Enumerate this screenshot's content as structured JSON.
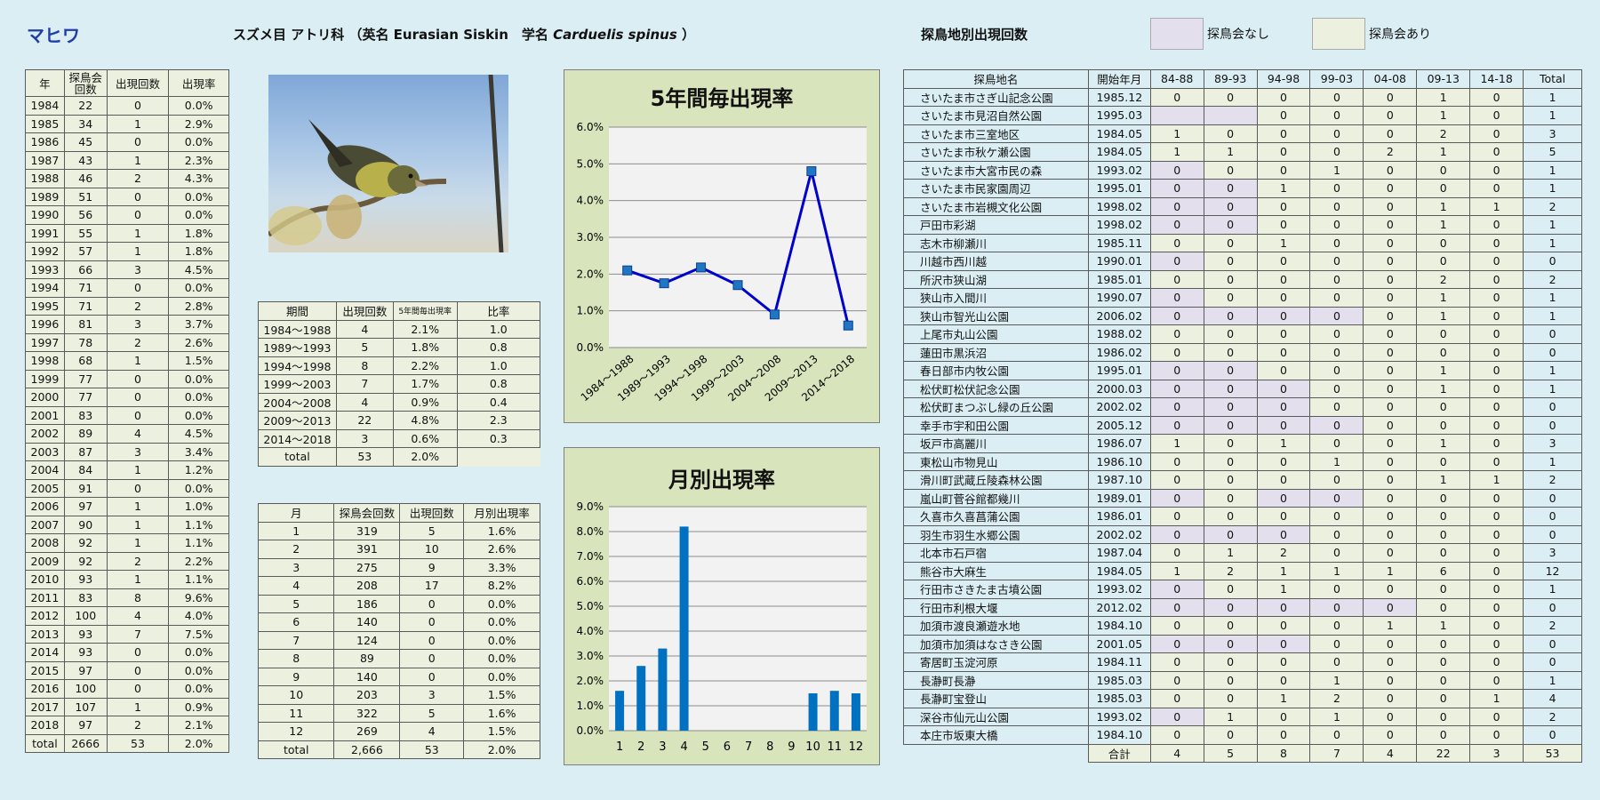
{
  "header": {
    "species": "マヒワ",
    "sub1": "スズメ目 アトリ科 （英名 Eurasian Siskin　学名 ",
    "sub_sci": "Carduelis spinus",
    "sub2": " ）",
    "sites_title": "探鳥地別出現回数",
    "legend_none": "探鳥会なし",
    "legend_held": "探鳥会あり"
  },
  "colors": {
    "no_event": "#e4dfec",
    "event": "#ebf1de",
    "line": "#0000cc",
    "marker": "#1f77c4",
    "bar": "#0070c0",
    "panel": "#d7e4bc"
  },
  "yearly": {
    "headers": [
      "年",
      "探鳥会回数",
      "出現回数",
      "出現率"
    ],
    "rows": [
      [
        "1984",
        "22",
        "0",
        "0.0%"
      ],
      [
        "1985",
        "34",
        "1",
        "2.9%"
      ],
      [
        "1986",
        "45",
        "0",
        "0.0%"
      ],
      [
        "1987",
        "43",
        "1",
        "2.3%"
      ],
      [
        "1988",
        "46",
        "2",
        "4.3%"
      ],
      [
        "1989",
        "51",
        "0",
        "0.0%"
      ],
      [
        "1990",
        "56",
        "0",
        "0.0%"
      ],
      [
        "1991",
        "55",
        "1",
        "1.8%"
      ],
      [
        "1992",
        "57",
        "1",
        "1.8%"
      ],
      [
        "1993",
        "66",
        "3",
        "4.5%"
      ],
      [
        "1994",
        "71",
        "0",
        "0.0%"
      ],
      [
        "1995",
        "71",
        "2",
        "2.8%"
      ],
      [
        "1996",
        "81",
        "3",
        "3.7%"
      ],
      [
        "1997",
        "78",
        "2",
        "2.6%"
      ],
      [
        "1998",
        "68",
        "1",
        "1.5%"
      ],
      [
        "1999",
        "77",
        "0",
        "0.0%"
      ],
      [
        "2000",
        "77",
        "0",
        "0.0%"
      ],
      [
        "2001",
        "83",
        "0",
        "0.0%"
      ],
      [
        "2002",
        "89",
        "4",
        "4.5%"
      ],
      [
        "2003",
        "87",
        "3",
        "3.4%"
      ],
      [
        "2004",
        "84",
        "1",
        "1.2%"
      ],
      [
        "2005",
        "91",
        "0",
        "0.0%"
      ],
      [
        "2006",
        "97",
        "1",
        "1.0%"
      ],
      [
        "2007",
        "90",
        "1",
        "1.1%"
      ],
      [
        "2008",
        "92",
        "1",
        "1.1%"
      ],
      [
        "2009",
        "92",
        "2",
        "2.2%"
      ],
      [
        "2010",
        "93",
        "1",
        "1.1%"
      ],
      [
        "2011",
        "83",
        "8",
        "9.6%"
      ],
      [
        "2012",
        "100",
        "4",
        "4.0%"
      ],
      [
        "2013",
        "93",
        "7",
        "7.5%"
      ],
      [
        "2014",
        "93",
        "0",
        "0.0%"
      ],
      [
        "2015",
        "97",
        "0",
        "0.0%"
      ],
      [
        "2016",
        "100",
        "0",
        "0.0%"
      ],
      [
        "2017",
        "107",
        "1",
        "0.9%"
      ],
      [
        "2018",
        "97",
        "2",
        "2.1%"
      ]
    ],
    "total": [
      "total",
      "2666",
      "53",
      "2.0%"
    ]
  },
  "period": {
    "headers": [
      "期間",
      "出現回数",
      "5年間毎出現率",
      "比率"
    ],
    "rows": [
      [
        "1984～1988",
        "4",
        "2.1%",
        "1.0"
      ],
      [
        "1989～1993",
        "5",
        "1.8%",
        "0.8"
      ],
      [
        "1994～1998",
        "8",
        "2.2%",
        "1.0"
      ],
      [
        "1999～2003",
        "7",
        "1.7%",
        "0.8"
      ],
      [
        "2004～2008",
        "4",
        "0.9%",
        "0.4"
      ],
      [
        "2009～2013",
        "22",
        "4.8%",
        "2.3"
      ],
      [
        "2014～2018",
        "3",
        "0.6%",
        "0.3"
      ]
    ],
    "total": [
      "total",
      "53",
      "2.0%"
    ]
  },
  "monthly": {
    "headers": [
      "月",
      "探鳥会回数",
      "出現回数",
      "月別出現率"
    ],
    "rows": [
      [
        "1",
        "319",
        "5",
        "1.6%"
      ],
      [
        "2",
        "391",
        "10",
        "2.6%"
      ],
      [
        "3",
        "275",
        "9",
        "3.3%"
      ],
      [
        "4",
        "208",
        "17",
        "8.2%"
      ],
      [
        "5",
        "186",
        "0",
        "0.0%"
      ],
      [
        "6",
        "140",
        "0",
        "0.0%"
      ],
      [
        "7",
        "124",
        "0",
        "0.0%"
      ],
      [
        "8",
        "89",
        "0",
        "0.0%"
      ],
      [
        "9",
        "140",
        "0",
        "0.0%"
      ],
      [
        "10",
        "203",
        "3",
        "1.5%"
      ],
      [
        "11",
        "322",
        "5",
        "1.6%"
      ],
      [
        "12",
        "269",
        "4",
        "1.5%"
      ]
    ],
    "total": [
      "total",
      "2,666",
      "53",
      "2.0%"
    ]
  },
  "chart_data": [
    {
      "type": "line",
      "title": "5年間毎出現率",
      "categories": [
        "1984～1988",
        "1989～1993",
        "1994～1998",
        "1999～2003",
        "2004～2008",
        "2009～2013",
        "2014～2018"
      ],
      "values": [
        2.1,
        1.75,
        2.18,
        1.7,
        0.9,
        4.8,
        0.6
      ],
      "ylim": [
        0,
        6
      ],
      "yticks": [
        "0.0%",
        "1.0%",
        "2.0%",
        "3.0%",
        "4.0%",
        "5.0%",
        "6.0%"
      ]
    },
    {
      "type": "bar",
      "title": "月別出現率",
      "categories": [
        "1",
        "2",
        "3",
        "4",
        "5",
        "6",
        "7",
        "8",
        "9",
        "10",
        "11",
        "12"
      ],
      "values": [
        1.6,
        2.6,
        3.3,
        8.2,
        0,
        0,
        0,
        0,
        0,
        1.5,
        1.6,
        1.5
      ],
      "ylim": [
        0,
        9
      ],
      "yticks": [
        "0.0%",
        "1.0%",
        "2.0%",
        "3.0%",
        "4.0%",
        "5.0%",
        "6.0%",
        "7.0%",
        "8.0%",
        "9.0%"
      ]
    }
  ],
  "sites": {
    "headers": [
      "探鳥地名",
      "開始年月",
      "84-88",
      "89-93",
      "94-98",
      "99-03",
      "04-08",
      "09-13",
      "14-18",
      "Total"
    ],
    "rows": [
      {
        "name": "さいたま市さぎ山記念公園",
        "start": "1985.12",
        "v": [
          "0",
          "0",
          "0",
          "0",
          "0",
          "1",
          "0",
          "1"
        ],
        "none": []
      },
      {
        "name": "さいたま市見沼自然公園",
        "start": "1995.03",
        "v": [
          "",
          "",
          "0",
          "0",
          "0",
          "1",
          "0",
          "1"
        ],
        "none": [
          0,
          1
        ]
      },
      {
        "name": "さいたま市三室地区",
        "start": "1984.05",
        "v": [
          "1",
          "0",
          "0",
          "0",
          "0",
          "2",
          "0",
          "3"
        ],
        "none": []
      },
      {
        "name": "さいたま市秋ケ瀬公園",
        "start": "1984.05",
        "v": [
          "1",
          "1",
          "0",
          "0",
          "2",
          "1",
          "0",
          "5"
        ],
        "none": []
      },
      {
        "name": "さいたま市大宮市民の森",
        "start": "1993.02",
        "v": [
          "0",
          "0",
          "0",
          "1",
          "0",
          "0",
          "0",
          "1"
        ],
        "none": [
          0
        ]
      },
      {
        "name": "さいたま市民家園周辺",
        "start": "1995.01",
        "v": [
          "0",
          "0",
          "1",
          "0",
          "0",
          "0",
          "0",
          "1"
        ],
        "none": [
          0,
          1
        ]
      },
      {
        "name": "さいたま市岩槻文化公園",
        "start": "1998.02",
        "v": [
          "0",
          "0",
          "0",
          "0",
          "0",
          "1",
          "1",
          "2"
        ],
        "none": [
          0,
          1
        ]
      },
      {
        "name": "戸田市彩湖",
        "start": "1998.02",
        "v": [
          "0",
          "0",
          "0",
          "0",
          "0",
          "1",
          "0",
          "1"
        ],
        "none": [
          0,
          1
        ]
      },
      {
        "name": "志木市柳瀬川",
        "start": "1985.11",
        "v": [
          "0",
          "0",
          "1",
          "0",
          "0",
          "0",
          "0",
          "1"
        ],
        "none": []
      },
      {
        "name": "川越市西川越",
        "start": "1990.01",
        "v": [
          "0",
          "0",
          "0",
          "0",
          "0",
          "0",
          "0",
          "0"
        ],
        "none": [
          0
        ]
      },
      {
        "name": "所沢市狭山湖",
        "start": "1985.01",
        "v": [
          "0",
          "0",
          "0",
          "0",
          "0",
          "2",
          "0",
          "2"
        ],
        "none": []
      },
      {
        "name": "狭山市入間川",
        "start": "1990.07",
        "v": [
          "0",
          "0",
          "0",
          "0",
          "0",
          "1",
          "0",
          "1"
        ],
        "none": [
          0
        ]
      },
      {
        "name": "狭山市智光山公園",
        "start": "2006.02",
        "v": [
          "0",
          "0",
          "0",
          "0",
          "0",
          "1",
          "0",
          "1"
        ],
        "none": [
          0,
          1,
          2,
          3
        ]
      },
      {
        "name": "上尾市丸山公園",
        "start": "1988.02",
        "v": [
          "0",
          "0",
          "0",
          "0",
          "0",
          "0",
          "0",
          "0"
        ],
        "none": []
      },
      {
        "name": "蓮田市黒浜沼",
        "start": "1986.02",
        "v": [
          "0",
          "0",
          "0",
          "0",
          "0",
          "0",
          "0",
          "0"
        ],
        "none": []
      },
      {
        "name": "春日部市内牧公園",
        "start": "1995.01",
        "v": [
          "0",
          "0",
          "0",
          "0",
          "0",
          "1",
          "0",
          "1"
        ],
        "none": [
          0,
          1
        ]
      },
      {
        "name": "松伏町松伏記念公園",
        "start": "2000.03",
        "v": [
          "0",
          "0",
          "0",
          "0",
          "0",
          "1",
          "0",
          "1"
        ],
        "none": [
          0,
          1,
          2
        ]
      },
      {
        "name": "松伏町まつぶし緑の丘公園",
        "start": "2002.02",
        "v": [
          "0",
          "0",
          "0",
          "0",
          "0",
          "0",
          "0",
          "0"
        ],
        "none": [
          0,
          1,
          2
        ]
      },
      {
        "name": "幸手市宇和田公園",
        "start": "2005.12",
        "v": [
          "0",
          "0",
          "0",
          "0",
          "0",
          "0",
          "0",
          "0"
        ],
        "none": [
          0,
          1,
          2,
          3
        ]
      },
      {
        "name": "坂戸市高麗川",
        "start": "1986.07",
        "v": [
          "1",
          "0",
          "1",
          "0",
          "0",
          "1",
          "0",
          "3"
        ],
        "none": []
      },
      {
        "name": "東松山市物見山",
        "start": "1986.10",
        "v": [
          "0",
          "0",
          "0",
          "1",
          "0",
          "0",
          "0",
          "1"
        ],
        "none": []
      },
      {
        "name": "滑川町武蔵丘陵森林公園",
        "start": "1987.10",
        "v": [
          "0",
          "0",
          "0",
          "0",
          "0",
          "1",
          "1",
          "2"
        ],
        "none": []
      },
      {
        "name": "嵐山町菅谷館都幾川",
        "start": "1989.01",
        "v": [
          "0",
          "0",
          "0",
          "0",
          "0",
          "0",
          "0",
          "0"
        ],
        "none": [
          0,
          2,
          3
        ]
      },
      {
        "name": "久喜市久喜菖蒲公園",
        "start": "1986.01",
        "v": [
          "0",
          "0",
          "0",
          "0",
          "0",
          "0",
          "0",
          "0"
        ],
        "none": []
      },
      {
        "name": "羽生市羽生水郷公園",
        "start": "2002.02",
        "v": [
          "0",
          "0",
          "0",
          "0",
          "0",
          "0",
          "0",
          "0"
        ],
        "none": [
          0,
          1,
          2
        ]
      },
      {
        "name": "北本市石戸宿",
        "start": "1987.04",
        "v": [
          "0",
          "1",
          "2",
          "0",
          "0",
          "0",
          "0",
          "3"
        ],
        "none": []
      },
      {
        "name": "熊谷市大麻生",
        "start": "1984.05",
        "v": [
          "1",
          "2",
          "1",
          "1",
          "1",
          "6",
          "0",
          "12"
        ],
        "none": []
      },
      {
        "name": "行田市さきたま古墳公園",
        "start": "1993.02",
        "v": [
          "0",
          "0",
          "1",
          "0",
          "0",
          "0",
          "0",
          "1"
        ],
        "none": [
          0
        ]
      },
      {
        "name": "行田市利根大堰",
        "start": "2012.02",
        "v": [
          "0",
          "0",
          "0",
          "0",
          "0",
          "0",
          "0",
          "0"
        ],
        "none": [
          0,
          1,
          2,
          3,
          4
        ]
      },
      {
        "name": "加須市渡良瀬遊水地",
        "start": "1984.10",
        "v": [
          "0",
          "0",
          "0",
          "0",
          "1",
          "1",
          "0",
          "2"
        ],
        "none": []
      },
      {
        "name": "加須市加須はなさき公園",
        "start": "2001.05",
        "v": [
          "0",
          "0",
          "0",
          "0",
          "0",
          "0",
          "0",
          "0"
        ],
        "none": [
          0,
          1,
          2
        ]
      },
      {
        "name": "寄居町玉淀河原",
        "start": "1984.11",
        "v": [
          "0",
          "0",
          "0",
          "0",
          "0",
          "0",
          "0",
          "0"
        ],
        "none": []
      },
      {
        "name": "長瀞町長瀞",
        "start": "1985.03",
        "v": [
          "0",
          "0",
          "0",
          "1",
          "0",
          "0",
          "0",
          "1"
        ],
        "none": []
      },
      {
        "name": "長瀞町宝登山",
        "start": "1985.03",
        "v": [
          "0",
          "0",
          "1",
          "2",
          "0",
          "0",
          "1",
          "4"
        ],
        "none": []
      },
      {
        "name": "深谷市仙元山公園",
        "start": "1993.02",
        "v": [
          "0",
          "1",
          "0",
          "1",
          "0",
          "0",
          "0",
          "2"
        ],
        "none": [
          0
        ]
      },
      {
        "name": "本庄市坂東大橋",
        "start": "1984.10",
        "v": [
          "0",
          "0",
          "0",
          "0",
          "0",
          "0",
          "0",
          "0"
        ],
        "none": []
      }
    ],
    "total_label": "合計",
    "totals": [
      "4",
      "5",
      "8",
      "7",
      "4",
      "22",
      "3",
      "53"
    ]
  }
}
